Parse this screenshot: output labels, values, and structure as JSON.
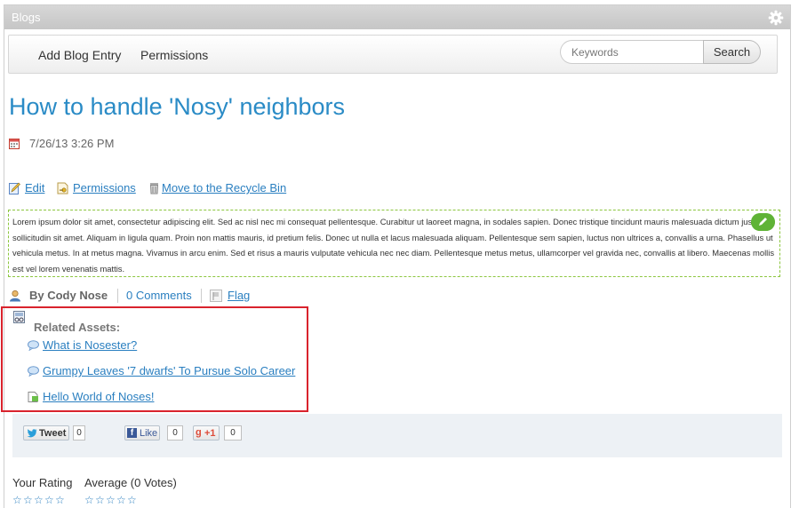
{
  "portlet": {
    "title": "Blogs",
    "settings_icon": "gear-icon"
  },
  "toolbar": {
    "add_blog_entry": "Add Blog Entry",
    "permissions": "Permissions",
    "search_placeholder": "Keywords",
    "search_button": "Search"
  },
  "entry": {
    "title": "How to handle 'Nosy' neighbors",
    "date": "7/26/13 3:26 PM",
    "actions": {
      "edit": "Edit",
      "permissions": "Permissions",
      "recycle": "Move to the Recycle Bin"
    },
    "content": "Lorem ipsum dolor sit amet, consectetur adipiscing elit. Sed ac nisl nec mi consequat pellentesque. Curabitur ut laoreet magna, in sodales sapien. Donec tristique tincidunt mauris malesuada dictum justo sollicitudin sit amet. Aliquam in ligula quam. Proin non mattis mauris, id pretium felis. Donec ut nulla et lacus malesuada aliquam. Pellentesque sem sapien, luctus non ultrices a, convallis a urna. Phasellus ut vehicula metus. In at metus magna. Vivamus in arcu enim. Sed et risus a mauris vulputate vehicula nec nec diam. Pellentesque metus metus, ullamcorper vel gravida nec, convallis at libero. Maecenas mollis est vel lorem venenatis mattis.",
    "author": "By Cody Nose",
    "comments": "0 Comments",
    "flag": "Flag"
  },
  "related": {
    "header": "Related Assets:",
    "items": [
      {
        "label": "What is Nosester?",
        "icon": "comment-icon"
      },
      {
        "label": "Grumpy Leaves '7 dwarfs' To Pursue Solo Career",
        "icon": "comment-icon"
      },
      {
        "label": "Hello World of Noses!",
        "icon": "document-icon"
      }
    ]
  },
  "social": {
    "tweet_label": "Tweet",
    "tweet_count": "0",
    "like_label": "Like",
    "like_count": "0",
    "plusone_label": "+1",
    "plusone_count": "0"
  },
  "ratings": {
    "your_rating": "Your Rating",
    "average": "Average (0 Votes)",
    "your_stars": 0,
    "average_stars": 0,
    "max_stars": 5
  },
  "colors": {
    "link": "#2a7fc0",
    "title": "#2a8bc6",
    "highlight_border": "#d9232d",
    "edit_border": "#8cc63f"
  }
}
